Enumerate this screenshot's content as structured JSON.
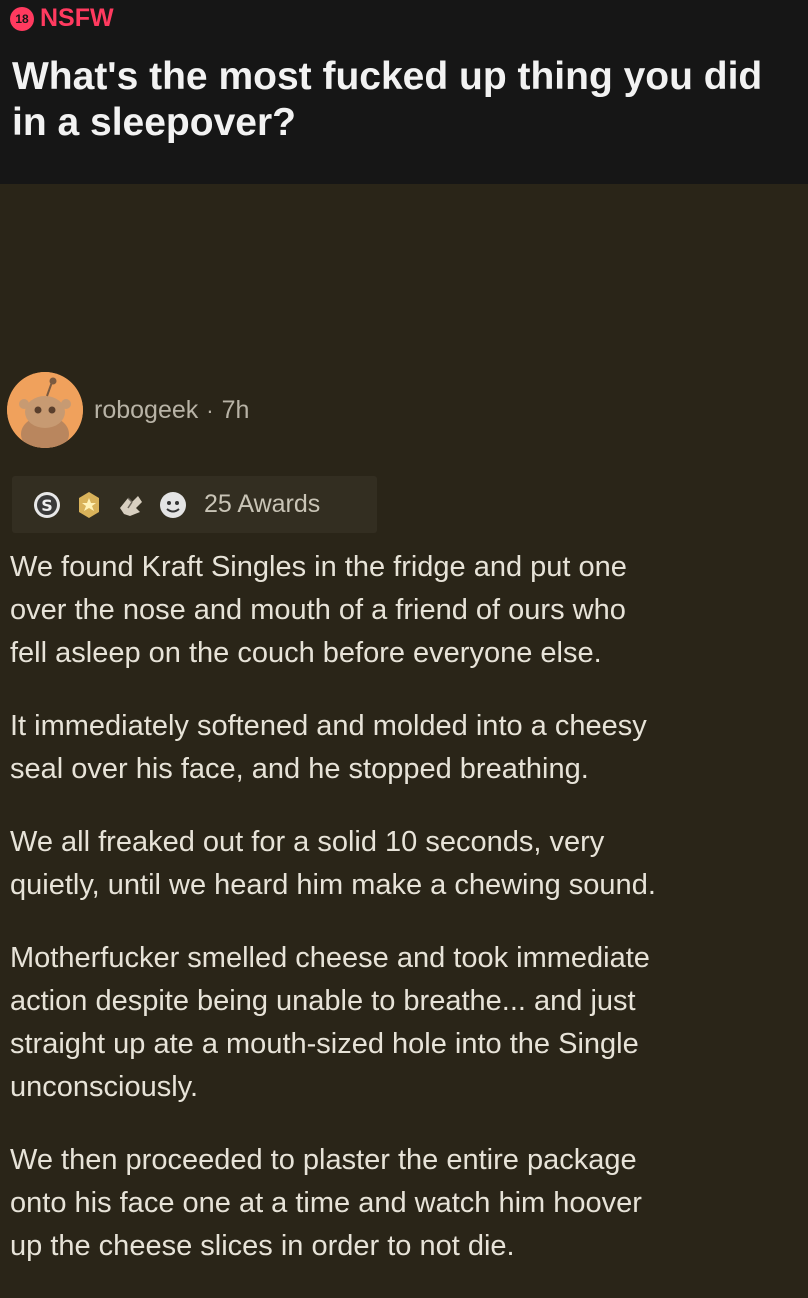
{
  "header": {
    "nsfw_badge": "18",
    "nsfw_label": "NSFW",
    "title": "What's the most fucked up thing you did in a sleepover?"
  },
  "comment": {
    "author": "robogeek",
    "separator": "·",
    "time": "7h",
    "awards_label": "25 Awards",
    "awards_icons": [
      "silver-coin-icon",
      "gold-star-award-icon",
      "hands-award-icon",
      "face-award-icon"
    ],
    "paragraphs": [
      [
        "We found Kraft Singles in the fridge and put one",
        "over the nose and mouth of a friend of ours who",
        "fell asleep on the couch before everyone else."
      ],
      [
        "It immediately softened and molded into a cheesy",
        "seal over his face, and he stopped breathing."
      ],
      [
        "We all freaked out for a solid 10 seconds, very",
        "quietly, until we heard him make a chewing sound."
      ],
      [
        "Motherfucker smelled cheese and took immediate",
        "action despite being unable to breathe... and just",
        "straight up ate a mouth-sized hole into the Single",
        "unconsciously."
      ],
      [
        "We then proceeded to plaster the entire package",
        "onto his face one at a time and watch him hoover",
        "up the cheese slices in order to not die."
      ]
    ]
  },
  "colors": {
    "header_bg": "#161616",
    "body_bg": "#2a2518",
    "nsfw": "#ff3a5f",
    "avatar": "#f0a15c"
  }
}
